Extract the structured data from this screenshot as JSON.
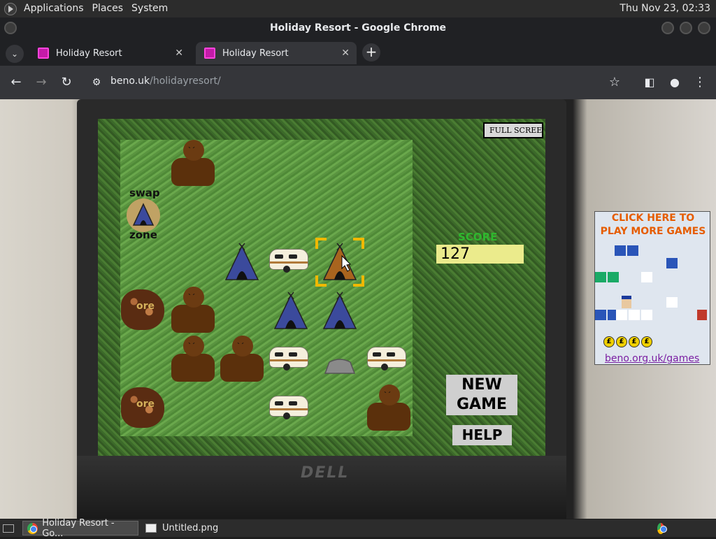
{
  "top_panel": {
    "menus": [
      "Applications",
      "Places",
      "System"
    ],
    "clock": "Thu Nov 23, 02:33"
  },
  "window": {
    "title": "Holiday Resort - Google Chrome"
  },
  "tabs": [
    {
      "label": "Holiday Resort",
      "close": "✕",
      "active": false
    },
    {
      "label": "Holiday Resort",
      "close": "✕",
      "active": true
    }
  ],
  "new_tab": "+",
  "address_bar": {
    "domain": "beno.uk",
    "path": "/holidayresort/"
  },
  "game": {
    "fullscreen_label": "FULL SCREEN",
    "swap_top": "swap",
    "swap_bottom": "zone",
    "score_label": "SCORE",
    "score_value": "127",
    "new_game_line1": "NEW",
    "new_game_line2": "GAME",
    "help_label": "HELP",
    "ore_label": "ore",
    "board": [
      {
        "item": "bear",
        "col": 1,
        "row": 0
      },
      {
        "item": "tent-blue",
        "col": 2,
        "row": 2
      },
      {
        "item": "caravan",
        "col": 3,
        "row": 2
      },
      {
        "item": "tent-brown",
        "col": 4,
        "row": 2,
        "selected": true
      },
      {
        "item": "ore",
        "col": 0,
        "row": 3
      },
      {
        "item": "bear",
        "col": 1,
        "row": 3
      },
      {
        "item": "tent-blue",
        "col": 3,
        "row": 3
      },
      {
        "item": "tent-blue",
        "col": 4,
        "row": 3
      },
      {
        "item": "bear",
        "col": 1,
        "row": 4
      },
      {
        "item": "bear",
        "col": 2,
        "row": 4
      },
      {
        "item": "caravan",
        "col": 3,
        "row": 4
      },
      {
        "item": "rock",
        "col": 4,
        "row": 4
      },
      {
        "item": "caravan",
        "col": 5,
        "row": 4
      },
      {
        "item": "ore",
        "col": 0,
        "row": 5
      },
      {
        "item": "caravan",
        "col": 3,
        "row": 5
      },
      {
        "item": "bear",
        "col": 5,
        "row": 5
      }
    ],
    "swap_zone_item": "tent-blue"
  },
  "ad": {
    "title_line1": "CLICK HERE TO",
    "title_line2": "PLAY MORE GAMES",
    "link": "beno.org.uk/games",
    "coin_symbol": "£"
  },
  "taskbar": {
    "items": [
      {
        "label": "Holiday Resort - Go...",
        "active": true
      },
      {
        "label": "Untitled.png",
        "active": false
      }
    ]
  },
  "colors": {
    "score_label": "#2eb82e",
    "score_box": "#ebeb8c",
    "ad_title": "#e65c00",
    "ad_link": "#7b1fa2",
    "select_bracket": "#f0b800",
    "tent_blue": "#3b4a9c",
    "tent_brown": "#a8641e"
  }
}
